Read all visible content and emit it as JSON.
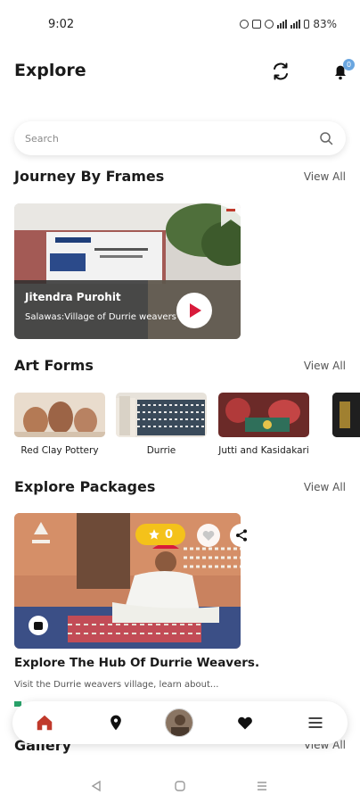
{
  "status_bar": {
    "time": "9:02",
    "battery": "83%"
  },
  "header": {
    "title": "Explore",
    "notification_count": "0"
  },
  "search": {
    "placeholder": "Search"
  },
  "journey": {
    "title": "Journey By Frames",
    "view_all": "View All",
    "card": {
      "title": "Jitendra Purohit",
      "subtitle": "Salawas:Village of Durrie weavers"
    }
  },
  "art_forms": {
    "title": "Art Forms",
    "view_all": "View All",
    "items": [
      {
        "label": "Red Clay Pottery"
      },
      {
        "label": "Durrie"
      },
      {
        "label": "Jutti and Kasidakari"
      }
    ]
  },
  "packages": {
    "title": "Explore Packages",
    "view_all": "View All",
    "card": {
      "rating": "0",
      "title": "Explore The Hub Of Durrie Weavers.",
      "description": "Visit the Durrie weavers village, learn about..."
    }
  },
  "gallery": {
    "title": "Gallery",
    "view_all": "View All"
  },
  "bottom_nav": {
    "items": [
      "home-icon",
      "location-icon",
      "profile-avatar",
      "heart-icon",
      "menu-icon"
    ],
    "active_color": "#c0392b"
  },
  "colors": {
    "accent_red": "#c0392b",
    "rating_yellow": "#f4c21a",
    "badge_blue": "#6aa6e0"
  }
}
